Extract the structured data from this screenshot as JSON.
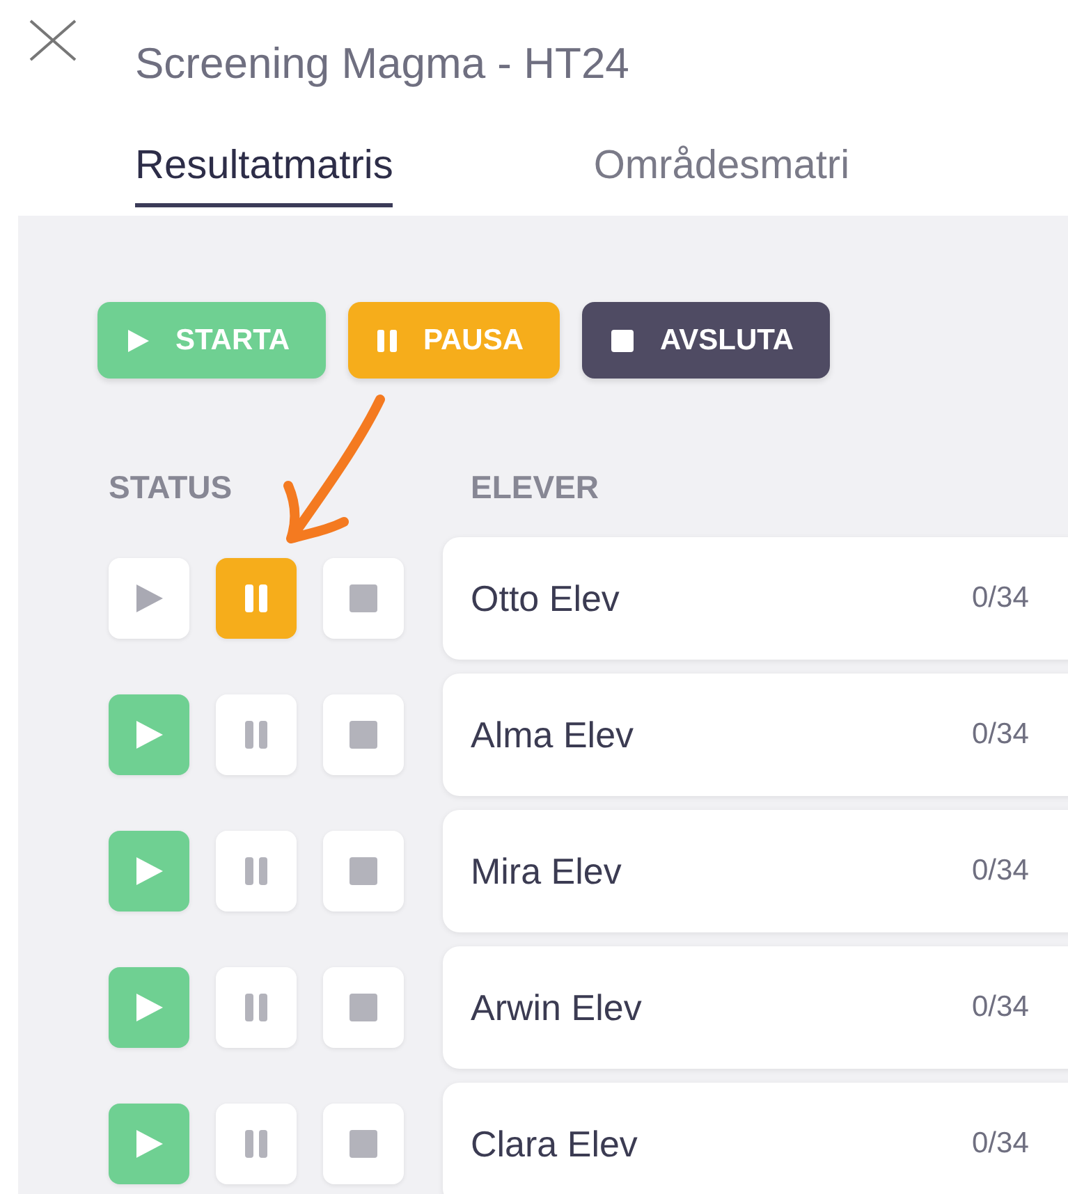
{
  "window": {
    "title": "Screening Magma - HT24"
  },
  "tabs": [
    {
      "label": "Resultatmatris",
      "selected": true
    },
    {
      "label": "Områdesmatri",
      "selected": false
    }
  ],
  "actions": [
    {
      "kind": "start",
      "label": "STARTA"
    },
    {
      "kind": "pause",
      "label": "PAUSA"
    },
    {
      "kind": "stop",
      "label": "AVSLUTA"
    }
  ],
  "columns": [
    "STATUS",
    "ELEVER"
  ],
  "students": [
    {
      "name": "Otto Elev",
      "score": "0/34",
      "started": false,
      "paused": true,
      "stopped": false
    },
    {
      "name": "Alma Elev",
      "score": "0/34",
      "started": true,
      "paused": false,
      "stopped": false
    },
    {
      "name": "Mira Elev",
      "score": "0/34",
      "started": true,
      "paused": false,
      "stopped": false
    },
    {
      "name": "Arwin Elev",
      "score": "0/34",
      "started": true,
      "paused": false,
      "stopped": false
    },
    {
      "name": "Clara Elev",
      "score": "0/34",
      "started": true,
      "paused": false,
      "stopped": false
    }
  ]
}
